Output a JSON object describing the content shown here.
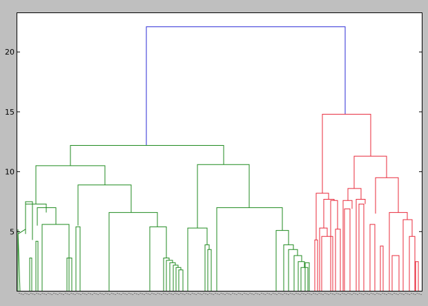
{
  "chart_data": {
    "type": "dendrogram",
    "title": "",
    "xlabel": "",
    "ylabel": "",
    "ylim": [
      0,
      23.3
    ],
    "yticks": [
      5,
      10,
      15,
      20
    ],
    "ytick_labels": [
      "5",
      "10",
      "15",
      "20"
    ],
    "grid": false,
    "legend": "none",
    "colors": {
      "root": "#2a2ad6",
      "cluster_green": "#1f8a1f",
      "cluster_red": "#e8283a",
      "axes_background": "#ffffff",
      "figure_background": "#bfbfbf",
      "frame": "#000000"
    },
    "links": [
      {
        "color": "root",
        "x": [
          212,
          212,
          500,
          500
        ],
        "y": [
          12.2,
          22.1,
          22.1,
          14.8
        ]
      },
      {
        "color": "cluster_green",
        "x": [
          102,
          102,
          324,
          324
        ],
        "y": [
          10.5,
          12.2,
          12.2,
          10.6
        ]
      },
      {
        "color": "cluster_green",
        "x": [
          52,
          52,
          152,
          152
        ],
        "y": [
          7.3,
          10.5,
          10.5,
          8.9
        ]
      },
      {
        "color": "cluster_green",
        "x": [
          37,
          37,
          67,
          67
        ],
        "y": [
          4.8,
          7.3,
          7.3,
          6.6
        ]
      },
      {
        "color": "cluster_green",
        "x": [
          26,
          26,
          37,
          37
        ],
        "y": [
          0,
          4.8,
          5.2,
          5.2
        ]
      },
      {
        "color": "cluster_green",
        "x": [
          37,
          37,
          47,
          47
        ],
        "y": [
          5.2,
          7.5,
          7.5,
          4.3
        ]
      },
      {
        "color": "cluster_green",
        "x": [
          26,
          26,
          29,
          29
        ],
        "y": [
          5.2,
          5.2,
          0,
          0
        ]
      },
      {
        "color": "cluster_green",
        "x": [
          43,
          43,
          46,
          46
        ],
        "y": [
          0,
          2.8,
          2.8,
          0
        ]
      },
      {
        "color": "cluster_green",
        "x": [
          52,
          52,
          55,
          55
        ],
        "y": [
          0,
          4.2,
          4.2,
          0
        ]
      },
      {
        "color": "cluster_green",
        "x": [
          54,
          54,
          81,
          81
        ],
        "y": [
          5.5,
          7.0,
          7.0,
          5.6
        ]
      },
      {
        "color": "cluster_green",
        "x": [
          61,
          61,
          100,
          100
        ],
        "y": [
          0,
          5.6,
          5.6,
          0
        ]
      },
      {
        "color": "cluster_green",
        "x": [
          97,
          97,
          104,
          104
        ],
        "y": [
          0,
          2.8,
          2.8,
          0
        ]
      },
      {
        "color": "cluster_green",
        "x": [
          113,
          113,
          190,
          190
        ],
        "y": [
          5.5,
          8.9,
          8.9,
          6.6
        ]
      },
      {
        "color": "cluster_green",
        "x": [
          110,
          110,
          116,
          116
        ],
        "y": [
          0,
          5.4,
          5.4,
          0
        ]
      },
      {
        "color": "cluster_green",
        "x": [
          158,
          158,
          228,
          228
        ],
        "y": [
          0,
          6.6,
          6.6,
          5.4
        ]
      },
      {
        "color": "cluster_green",
        "x": [
          217,
          217,
          241,
          241
        ],
        "y": [
          0,
          5.4,
          5.4,
          2.8
        ]
      },
      {
        "color": "cluster_green",
        "x": [
          237,
          237,
          245,
          245
        ],
        "y": [
          0,
          2.8,
          2.8,
          2.6
        ]
      },
      {
        "color": "cluster_green",
        "x": [
          241,
          241,
          250,
          250
        ],
        "y": [
          0,
          2.6,
          2.6,
          2.4
        ]
      },
      {
        "color": "cluster_green",
        "x": [
          246,
          246,
          254,
          254
        ],
        "y": [
          0,
          2.4,
          2.4,
          2.2
        ]
      },
      {
        "color": "cluster_green",
        "x": [
          251,
          251,
          258,
          258
        ],
        "y": [
          0,
          2.2,
          2.2,
          2.0
        ]
      },
      {
        "color": "cluster_green",
        "x": [
          255,
          255,
          262,
          262
        ],
        "y": [
          0,
          2.0,
          2.0,
          1.8
        ]
      },
      {
        "color": "cluster_green",
        "x": [
          259,
          259,
          265,
          265
        ],
        "y": [
          0,
          1.8,
          1.8,
          0
        ]
      },
      {
        "color": "cluster_green",
        "x": [
          286,
          286,
          361,
          361
        ],
        "y": [
          5.3,
          10.6,
          10.6,
          7.0
        ]
      },
      {
        "color": "cluster_green",
        "x": [
          272,
          272,
          300,
          300
        ],
        "y": [
          0,
          5.3,
          5.3,
          3.9
        ]
      },
      {
        "color": "cluster_green",
        "x": [
          297,
          297,
          303,
          303
        ],
        "y": [
          0,
          3.9,
          3.9,
          3.5
        ]
      },
      {
        "color": "cluster_green",
        "x": [
          301,
          301,
          306,
          306
        ],
        "y": [
          0,
          3.5,
          3.5,
          0
        ]
      },
      {
        "color": "cluster_green",
        "x": [
          314,
          314,
          409,
          409
        ],
        "y": [
          0,
          7.0,
          7.0,
          5.1
        ]
      },
      {
        "color": "cluster_green",
        "x": [
          400,
          400,
          418,
          418
        ],
        "y": [
          0,
          5.1,
          5.1,
          3.9
        ]
      },
      {
        "color": "cluster_green",
        "x": [
          411,
          411,
          425,
          425
        ],
        "y": [
          0,
          3.9,
          3.9,
          3.5
        ]
      },
      {
        "color": "cluster_green",
        "x": [
          418,
          418,
          431,
          431
        ],
        "y": [
          0,
          3.5,
          3.5,
          3.0
        ]
      },
      {
        "color": "cluster_green",
        "x": [
          426,
          426,
          437,
          437
        ],
        "y": [
          0,
          3.0,
          3.0,
          2.5
        ]
      },
      {
        "color": "cluster_green",
        "x": [
          432,
          432,
          441,
          441
        ],
        "y": [
          0,
          2.5,
          2.5,
          2.0
        ]
      },
      {
        "color": "cluster_green",
        "x": [
          436,
          436,
          446,
          446
        ],
        "y": [
          0,
          2.0,
          2.0,
          0
        ]
      },
      {
        "color": "cluster_green",
        "x": [
          442,
          442,
          448,
          448
        ],
        "y": [
          0,
          2.4,
          2.4,
          0
        ]
      },
      {
        "color": "cluster_red",
        "x": [
          467,
          467,
          537,
          537
        ],
        "y": [
          8.2,
          14.8,
          14.8,
          11.3
        ]
      },
      {
        "color": "cluster_red",
        "x": [
          458,
          458,
          476,
          476
        ],
        "y": [
          4.3,
          8.2,
          8.2,
          7.7
        ]
      },
      {
        "color": "cluster_red",
        "x": [
          456,
          456,
          460,
          460
        ],
        "y": [
          0,
          4.3,
          4.3,
          0
        ]
      },
      {
        "color": "cluster_red",
        "x": [
          469,
          469,
          484,
          484
        ],
        "y": [
          5.3,
          7.7,
          7.7,
          7.6
        ]
      },
      {
        "color": "cluster_red",
        "x": [
          463,
          463,
          474,
          474
        ],
        "y": [
          0,
          5.3,
          5.3,
          4.6
        ]
      },
      {
        "color": "cluster_red",
        "x": [
          466,
          466,
          482,
          482
        ],
        "y": [
          0,
          4.6,
          4.6,
          0
        ]
      },
      {
        "color": "cluster_red",
        "x": [
          479,
          479,
          489,
          489
        ],
        "y": [
          0,
          7.6,
          7.6,
          5.2
        ]
      },
      {
        "color": "cluster_red",
        "x": [
          486,
          486,
          493,
          493
        ],
        "y": [
          0,
          5.2,
          5.2,
          0
        ]
      },
      {
        "color": "cluster_red",
        "x": [
          513,
          513,
          560,
          560
        ],
        "y": [
          8.6,
          11.3,
          11.3,
          9.5
        ]
      },
      {
        "color": "cluster_red",
        "x": [
          504,
          504,
          523,
          523
        ],
        "y": [
          7.6,
          8.6,
          8.6,
          7.7
        ]
      },
      {
        "color": "cluster_red",
        "x": [
          497,
          497,
          510,
          510
        ],
        "y": [
          0,
          7.6,
          7.6,
          6.9
        ]
      },
      {
        "color": "cluster_red",
        "x": [
          499,
          499,
          507,
          507
        ],
        "y": [
          0,
          6.9,
          6.9,
          0
        ]
      },
      {
        "color": "cluster_red",
        "x": [
          516,
          516,
          529,
          529
        ],
        "y": [
          0,
          7.7,
          7.7,
          7.3
        ]
      },
      {
        "color": "cluster_red",
        "x": [
          520,
          520,
          527,
          527
        ],
        "y": [
          0,
          7.3,
          7.3,
          0
        ]
      },
      {
        "color": "cluster_red",
        "x": [
          536,
          536,
          543,
          543
        ],
        "y": [
          0,
          5.6,
          5.6,
          0
        ]
      },
      {
        "color": "cluster_red",
        "x": [
          544,
          544,
          577,
          577
        ],
        "y": [
          6.5,
          9.5,
          9.5,
          6.6
        ]
      },
      {
        "color": "cluster_red",
        "x": [
          551,
          551,
          555,
          555
        ],
        "y": [
          0,
          3.8,
          3.8,
          0
        ]
      },
      {
        "color": "cluster_red",
        "x": [
          564,
          564,
          590,
          590
        ],
        "y": [
          0,
          6.6,
          6.6,
          6.0
        ]
      },
      {
        "color": "cluster_red",
        "x": [
          584,
          584,
          597,
          597
        ],
        "y": [
          0,
          6.0,
          6.0,
          4.6
        ]
      },
      {
        "color": "cluster_red",
        "x": [
          593,
          593,
          601,
          601
        ],
        "y": [
          0,
          4.6,
          4.6,
          0
        ]
      },
      {
        "color": "cluster_red",
        "x": [
          568,
          568,
          578,
          578
        ],
        "y": [
          0,
          3.0,
          3.0,
          0
        ]
      },
      {
        "color": "cluster_red",
        "x": [
          602,
          602,
          606,
          606
        ],
        "y": [
          0,
          2.5,
          2.5,
          0
        ]
      }
    ],
    "leaf_count": 210
  }
}
